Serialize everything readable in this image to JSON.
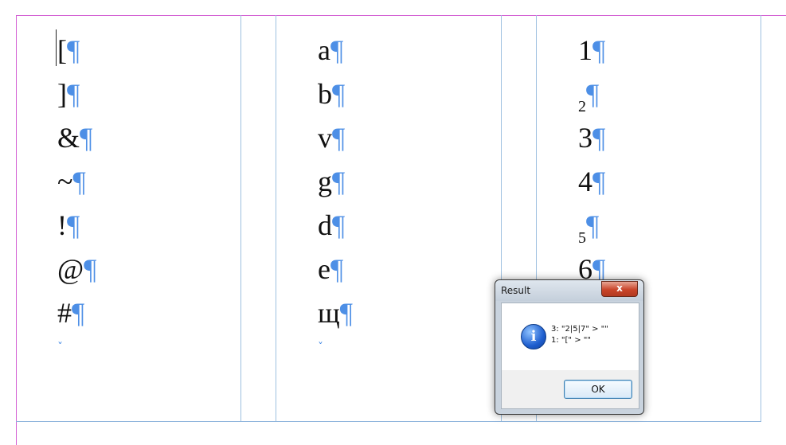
{
  "columns": [
    {
      "paragraphs": [
        {
          "text": "[",
          "sub": false
        },
        {
          "text": "]",
          "sub": false
        },
        {
          "text": "&",
          "sub": false
        },
        {
          "text": "~",
          "sub": false
        },
        {
          "text": "!",
          "sub": false
        },
        {
          "text": "@",
          "sub": false
        },
        {
          "text": "#",
          "sub": false
        }
      ],
      "end_mark": "ˇ"
    },
    {
      "paragraphs": [
        {
          "text": "a",
          "sub": false
        },
        {
          "text": "b",
          "sub": false
        },
        {
          "text": "v",
          "sub": false
        },
        {
          "text": "g",
          "sub": false
        },
        {
          "text": "d",
          "sub": false
        },
        {
          "text": "e",
          "sub": false
        },
        {
          "text": "щ",
          "sub": false
        }
      ],
      "end_mark": "ˇ"
    },
    {
      "paragraphs": [
        {
          "text": "1",
          "sub": false
        },
        {
          "text": "2",
          "sub": true
        },
        {
          "text": "3",
          "sub": false
        },
        {
          "text": "4",
          "sub": false
        },
        {
          "text": "5",
          "sub": true
        },
        {
          "text": "6",
          "sub": false
        }
      ],
      "end_mark": ""
    }
  ],
  "pilcrow": "¶",
  "dialog": {
    "title": "Result",
    "close_label": "x",
    "icon": "info-icon",
    "icon_glyph": "i",
    "message_lines": [
      "3: \"2|5|7\" > \"\"",
      "1: \"[\" > \"\""
    ],
    "ok_label": "OK"
  },
  "colors": {
    "margin_guide": "#d35fd3",
    "column_guide": "#9ec0e0",
    "hidden_chars": "#4d8fe6"
  }
}
